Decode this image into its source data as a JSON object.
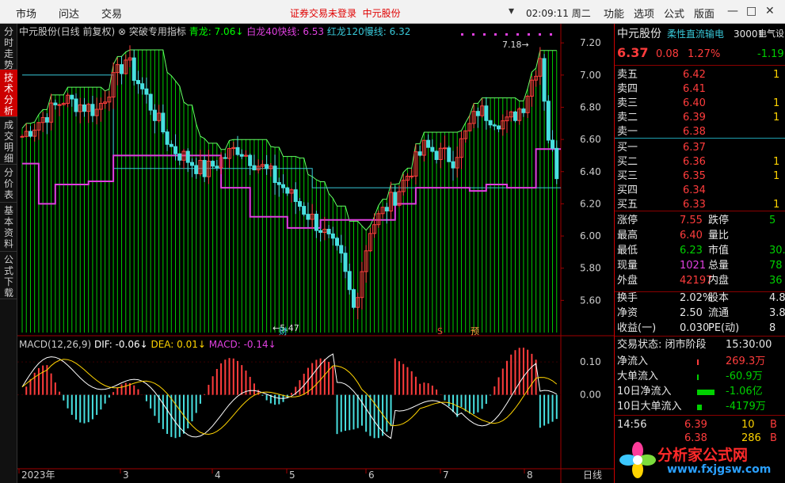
{
  "topbar": {
    "menu": [
      "市场",
      "问达",
      "交易"
    ],
    "notice": "证券交易未登录",
    "stock": "中元股份",
    "time": "02:09:11 周二",
    "right_menu": [
      "功能",
      "选项",
      "公式",
      "版面"
    ]
  },
  "sidetabs": [
    "分时走势",
    "技术分析",
    "成交明细",
    "分价表",
    "基本资料",
    "公式下载"
  ],
  "chart": {
    "title_stock": "中元股份(日线 前复权)",
    "indicator": "突破专用指标",
    "legend1": [
      {
        "text": "青龙: 7.06↓",
        "color": "#00ff00"
      },
      {
        "text": "白龙40快线: 6.53",
        "color": "#e040e0"
      },
      {
        "text": "红龙120慢线: 6.32",
        "color": "#38c8d8"
      }
    ],
    "price_ticks": [
      "7.20",
      "7.00",
      "6.80",
      "6.60",
      "6.40",
      "6.20",
      "6.00",
      "5.80",
      "5.60"
    ],
    "high_label": "7.18",
    "low_label": "5.47",
    "markers": [
      "财",
      "S",
      "预"
    ],
    "macd_legend": [
      {
        "text": "MACD(12,26,9)",
        "color": "#cccccc"
      },
      {
        "text": "DIF: -0.06↓",
        "color": "#ffffff"
      },
      {
        "text": "DEA: 0.01↓",
        "color": "#ffd400"
      },
      {
        "text": "MACD: -0.14↓",
        "color": "#e040e0"
      }
    ],
    "macd_ticks": [
      "0.10",
      "0.00"
    ],
    "x_labels": [
      "2023年",
      "3",
      "4",
      "5",
      "6",
      "7",
      "8"
    ],
    "period": "日线"
  },
  "chart_data": {
    "type": "candlestick",
    "price_range": [
      5.4,
      7.25
    ],
    "macd_range": [
      -0.22,
      0.17
    ]
  },
  "quote": {
    "name": "中元股份",
    "concept": "柔性直流输电",
    "code": "30001",
    "industry": "电气设",
    "price": "6.37",
    "change": "0.08",
    "pct": "1.27%",
    "side_value": "-1.19",
    "sells": [
      {
        "l": "卖五",
        "p": "6.42",
        "v": "1"
      },
      {
        "l": "卖四",
        "p": "6.41",
        "v": ""
      },
      {
        "l": "卖三",
        "p": "6.40",
        "v": "1"
      },
      {
        "l": "卖二",
        "p": "6.39",
        "v": "1"
      },
      {
        "l": "卖一",
        "p": "6.38",
        "v": ""
      }
    ],
    "buys": [
      {
        "l": "买一",
        "p": "6.37",
        "v": ""
      },
      {
        "l": "买二",
        "p": "6.36",
        "v": "1"
      },
      {
        "l": "买三",
        "p": "6.35",
        "v": "1"
      },
      {
        "l": "买四",
        "p": "6.34",
        "v": ""
      },
      {
        "l": "买五",
        "p": "6.33",
        "v": "1"
      }
    ],
    "stats": [
      {
        "l": "涨停",
        "v": "7.55",
        "c": "red",
        "l2": "跌停",
        "v2": "5"
      },
      {
        "l": "最高",
        "v": "6.40",
        "c": "red",
        "l2": "量比",
        "v2": ""
      },
      {
        "l": "最低",
        "v": "6.23",
        "c": "grn",
        "l2": "市值",
        "v2": "30."
      },
      {
        "l": "现量",
        "v": "1021",
        "c": "mag",
        "l2": "总量",
        "v2": "78"
      },
      {
        "l": "外盘",
        "v": "42197",
        "c": "red",
        "l2": "内盘",
        "v2": "36"
      }
    ],
    "stats2": [
      {
        "l": "换手",
        "v": "2.02%",
        "l2": "股本",
        "v2": "4.8"
      },
      {
        "l": "净资",
        "v": "2.50",
        "l2": "流通",
        "v2": "3.8"
      },
      {
        "l": "收益(一)",
        "v": "0.030",
        "l2": "PE(动)",
        "v2": "8"
      }
    ],
    "trade_status": "交易状态: 闭市阶段",
    "trade_time": "15:30:00",
    "flows": [
      {
        "l": "净流入",
        "v": "269.3万",
        "c": "red"
      },
      {
        "l": "大单流入",
        "v": "-60.9万",
        "c": "grn"
      },
      {
        "l": "10日净流入",
        "v": "-1.06亿",
        "c": "grn"
      },
      {
        "l": "10日大单流入",
        "v": "-4179万",
        "c": "grn"
      }
    ],
    "ticks": [
      {
        "t": "14:56",
        "p": "6.39",
        "v": "10",
        "s": "B"
      },
      {
        "t": "",
        "p": "6.38",
        "v": "286",
        "s": "B"
      }
    ],
    "watermark": "分析家公式网",
    "watermark_url": "www.fxjgsw.com"
  }
}
